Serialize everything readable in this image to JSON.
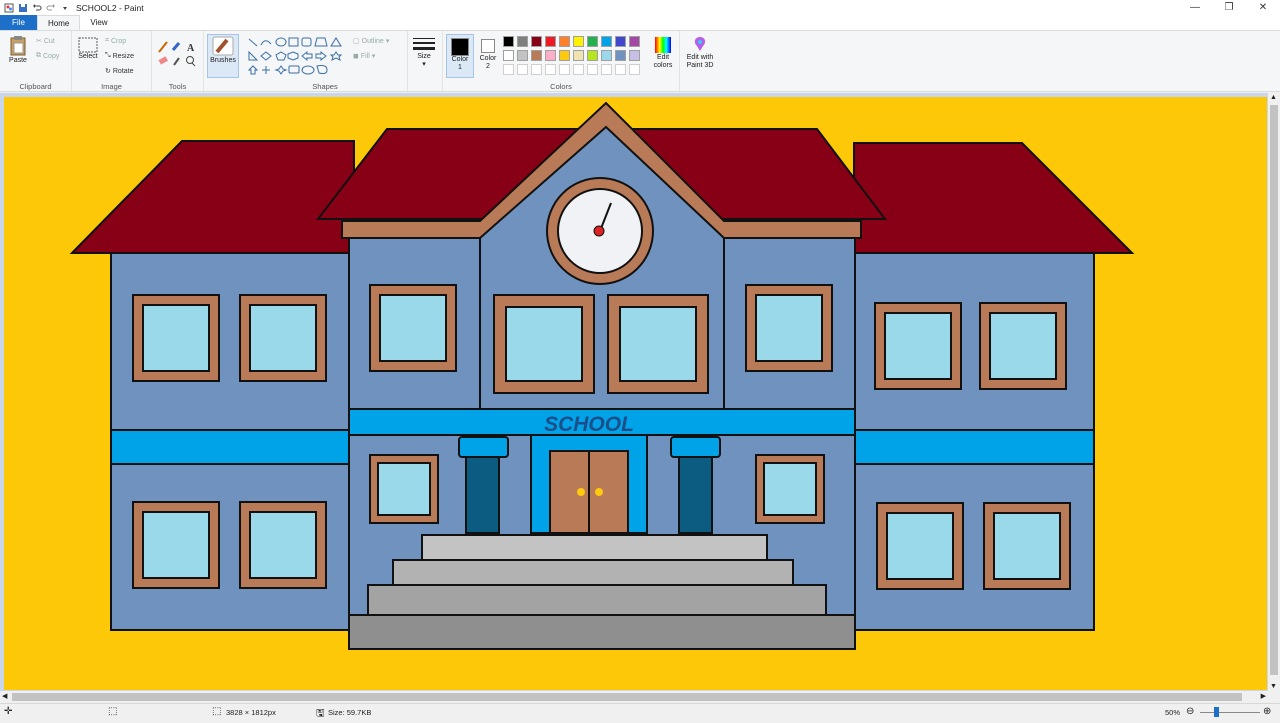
{
  "window": {
    "title": "SCHOOL2 - Paint"
  },
  "tabs": [
    {
      "label": "File"
    },
    {
      "label": "Home"
    },
    {
      "label": "View"
    }
  ],
  "clipboard": {
    "paste": "Paste",
    "cut": "Cut",
    "copy": "Copy",
    "label": "Clipboard"
  },
  "image": {
    "select": "Select",
    "crop": "Crop",
    "resize": "Resize",
    "rotate": "Rotate",
    "label": "Image"
  },
  "tools": {
    "label": "Tools",
    "brushes": "Brushes"
  },
  "shapes": {
    "outline": "Outline",
    "fill": "Fill",
    "label": "Shapes"
  },
  "size": {
    "label": "Size"
  },
  "colors": {
    "color1": "Color 1",
    "color2": "Color 2",
    "edit_colors": "Edit colors",
    "paint3d": "Edit with Paint 3D",
    "label": "Colors",
    "color1_value": "#000000",
    "color2_value": "#ffffff",
    "palette_row1": [
      "#000000",
      "#7f7f7f",
      "#880015",
      "#ed1c24",
      "#ff7f27",
      "#fff200",
      "#22b14c",
      "#00a2e8",
      "#3f48cc",
      "#a349a4"
    ],
    "palette_row2": [
      "#ffffff",
      "#c3c3c3",
      "#b97a57",
      "#ffaec9",
      "#ffc90e",
      "#efe4b0",
      "#b5e61d",
      "#99d9ea",
      "#7092be",
      "#c8bfe7"
    ]
  },
  "drawing": {
    "sign_text": "SCHOOL",
    "background": "#fdc808",
    "roof": "#880015",
    "wall": "#7092be",
    "window_frame": "#b97a57",
    "glass": "#99d9ea",
    "band": "#00a2e8"
  },
  "status": {
    "dimensions": "3828 × 1812px",
    "size": "Size: 59.7KB",
    "zoom": "50%"
  }
}
